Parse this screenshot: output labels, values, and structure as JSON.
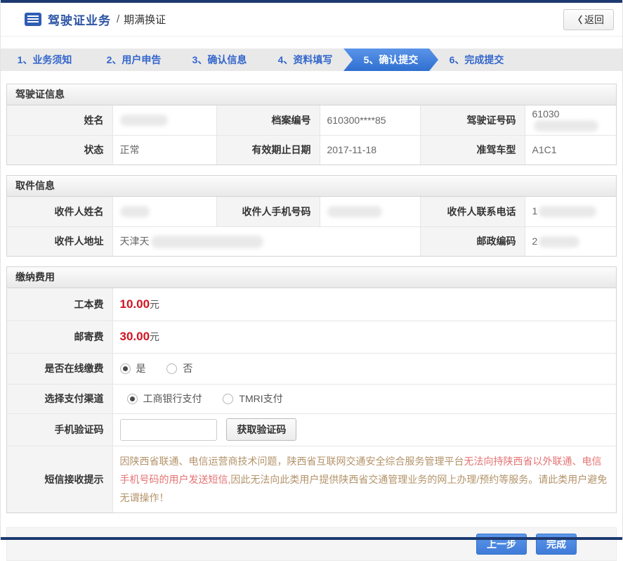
{
  "header": {
    "title": "驾驶证业务",
    "divider": "/",
    "subtitle": "期满换证",
    "back": {
      "chevron": "〈",
      "label": "返回"
    }
  },
  "steps": [
    {
      "label": "1、业务须知"
    },
    {
      "label": "2、用户申告"
    },
    {
      "label": "3、确认信息"
    },
    {
      "label": "4、资料填写"
    },
    {
      "label": "5、确认提交"
    },
    {
      "label": "6、完成提交"
    }
  ],
  "license_section": {
    "title": "驾驶证信息",
    "name_label": "姓名",
    "file_no_label": "档案编号",
    "file_no_value": "610300****85",
    "license_no_label": "驾驶证号码",
    "license_no_prefix": "61030",
    "status_label": "状态",
    "status_value": "正常",
    "expiry_label": "有效期止日期",
    "expiry_value": "2017-11-18",
    "class_label": "准驾车型",
    "class_value": "A1C1"
  },
  "pickup_section": {
    "title": "取件信息",
    "recipient_name_label": "收件人姓名",
    "recipient_mobile_label": "收件人手机号码",
    "recipient_tel_label": "收件人联系电话",
    "recipient_tel_prefix": "1",
    "address_label": "收件人地址",
    "address_prefix": "天津天",
    "postcode_label": "邮政编码",
    "postcode_prefix": "2"
  },
  "fees_section": {
    "title": "缴纳费用",
    "work_fee_label": "工本费",
    "work_fee_amount": "10.00",
    "work_fee_unit": "元",
    "postage_label": "邮寄费",
    "postage_amount": "30.00",
    "postage_unit": "元",
    "online_pay_label": "是否在线缴费",
    "online_yes": "是",
    "online_no": "否",
    "channel_label": "选择支付渠道",
    "channel_icbc": "工商银行支付",
    "channel_tmri": "TMRI支付",
    "sms_code_label": "手机验证码",
    "sms_code_value": "",
    "get_code_button": "获取验证码",
    "notice_label": "短信接收提示",
    "notice_part1": "因陕西省联通、电信运营商技术问题，陕西省互联网交通安全综合服务管理平台",
    "notice_part2": "无法向持陕西省以外联通、电信手机号码的用户发送短信,",
    "notice_part3": "因此无法向此类用户提供陕西省交通管理业务的网上办理/预约等服务。请此类用户避免无谓操作！"
  },
  "footer": {
    "prev_button": "上一步",
    "finish_button": "完成"
  },
  "colors": {
    "accent_blue": "#3c79d8",
    "navy_line": "#1d3a70",
    "fee_red": "#cf1322",
    "notice_tan": "#b3936a",
    "notice_red": "#e57373"
  }
}
